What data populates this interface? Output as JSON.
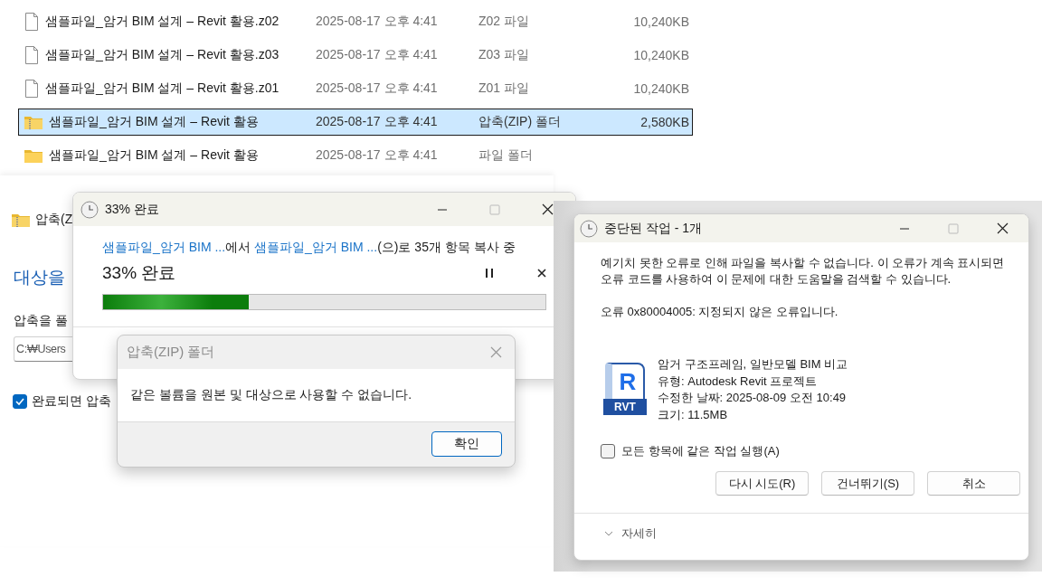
{
  "files": [
    {
      "kind": "file",
      "name": "샘플파일_암거 BIM 설계 – Revit 활용.z02",
      "modified": "2025-08-17 오후 4:41",
      "type": "Z02 파일",
      "size": "10,240KB",
      "selected": false
    },
    {
      "kind": "file",
      "name": "샘플파일_암거 BIM 설계 – Revit 활용.z03",
      "modified": "2025-08-17 오후 4:41",
      "type": "Z03 파일",
      "size": "10,240KB",
      "selected": false
    },
    {
      "kind": "file",
      "name": "샘플파일_암거 BIM 설계 – Revit 활용.z01",
      "modified": "2025-08-17 오후 4:41",
      "type": "Z01 파일",
      "size": "10,240KB",
      "selected": false
    },
    {
      "kind": "zip",
      "name": "샘플파일_암거 BIM 설계 – Revit 활용",
      "modified": "2025-08-17 오후 4:41",
      "type": "압축(ZIP) 폴더",
      "size": "2,580KB",
      "selected": true
    },
    {
      "kind": "folder",
      "name": "샘플파일_암거 BIM 설계 – Revit 활용",
      "modified": "2025-08-17 오후 4:41",
      "type": "파일 폴더",
      "selected": false
    }
  ],
  "extract_wizard": {
    "location": "압축(Z",
    "heading": "대상을",
    "field_label": "압축을 풀",
    "path_value": "C:₩Users",
    "show_files_label": "완료되면 압축",
    "show_files_checked": true
  },
  "progress_window": {
    "title": "33% 완료",
    "source": "샘플파일_암거 BIM ...",
    "from_text": "에서",
    "destination": "샘플파일_암거 BIM ...",
    "to_text": "(으)로 35개 항목 복사 중",
    "status": "33% 완료",
    "level": 0.33
  },
  "zip_dialog": {
    "title": "압축(ZIP) 폴더",
    "message": "같은 볼륨을 원본 및 대상으로 사용할 수 없습니다.",
    "button": "확인"
  },
  "error_window": {
    "title": "중단된 작업 - 1개",
    "message": "예기치 못한 오류로 인해 파일을 복사할 수 없습니다. 이 오류가 계속 표시되면 오류 코드를 사용하여 이 문제에 대한 도움말을 검색할 수 있습니다.",
    "error": "오류 0x80004005: 지정되지 않은 오류입니다.",
    "file": {
      "icon_letter": "R",
      "badge": "RVT",
      "name": "암거 구조프레임, 일반모델 BIM 비교",
      "type": "유형: Autodesk Revit 프로젝트",
      "modified": "수정한 날짜: 2025-08-09 오전 10:49",
      "size": "크기: 11.5MB"
    },
    "apply_all_label": "모든 항목에 같은 작업 실행(A)",
    "apply_all_checked": false,
    "buttons": [
      "다시 시도(R)",
      "건너뛰기(S)",
      "취소"
    ],
    "details": "자세히"
  }
}
